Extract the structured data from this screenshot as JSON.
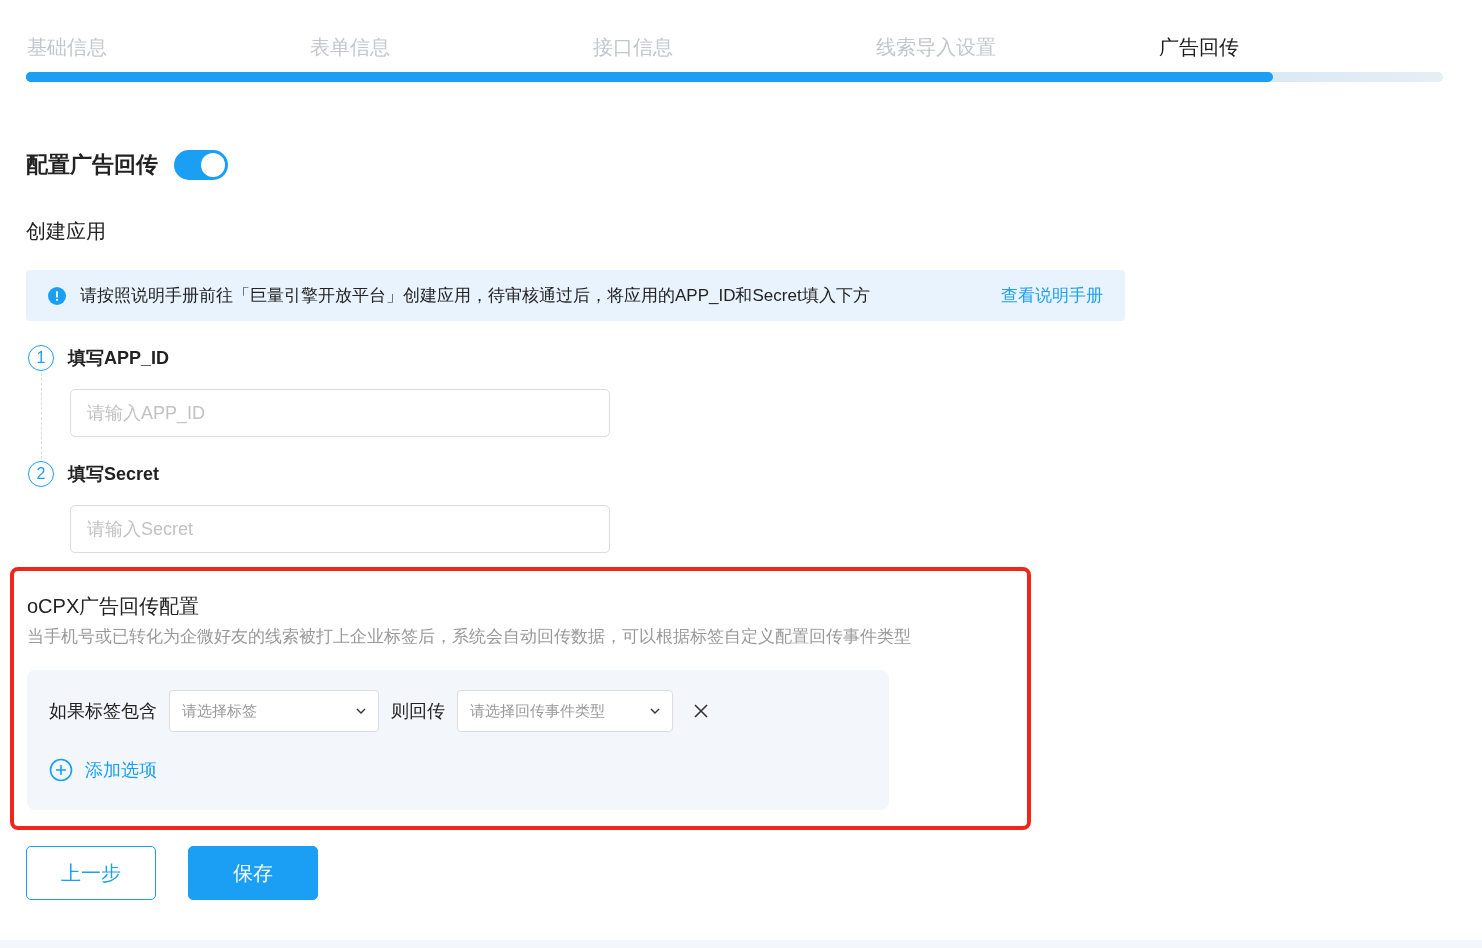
{
  "steps": [
    {
      "label": "基础信息",
      "selected": false
    },
    {
      "label": "表单信息",
      "selected": false
    },
    {
      "label": "接口信息",
      "selected": false
    },
    {
      "label": "线索导入设置",
      "selected": false
    },
    {
      "label": "广告回传",
      "selected": true
    }
  ],
  "progress": {
    "level": 0.88
  },
  "ad_callback": {
    "label": "配置广告回传",
    "on": true
  },
  "create_app": {
    "title": "创建应用",
    "notice": {
      "text": "请按照说明手册前往「巨量引擎开放平台」创建应用，待审核通过后，将应用的APP_ID和Secret填入下方",
      "link": "查看说明手册"
    },
    "fields": [
      {
        "number": "1",
        "label": "填写APP_ID",
        "placeholder": "请输入APP_ID"
      },
      {
        "number": "2",
        "label": "填写Secret",
        "placeholder": "请输入Secret"
      }
    ]
  },
  "ocpx": {
    "title": "oCPX广告回传配置",
    "description": "当手机号或已转化为企微好友的线索被打上企业标签后，系统会自动回传数据，可以根据标签自定义配置回传事件类型",
    "rules": [
      {
        "if_label": "如果标签包含",
        "tag_placeholder": "请选择标签",
        "then_label": "则回传",
        "event_placeholder": "请选择回传事件类型"
      }
    ],
    "add_option": "添加选项"
  },
  "buttons": [
    {
      "label": "上一步",
      "kind": "secondary"
    },
    {
      "label": "保存",
      "kind": "primary"
    }
  ]
}
